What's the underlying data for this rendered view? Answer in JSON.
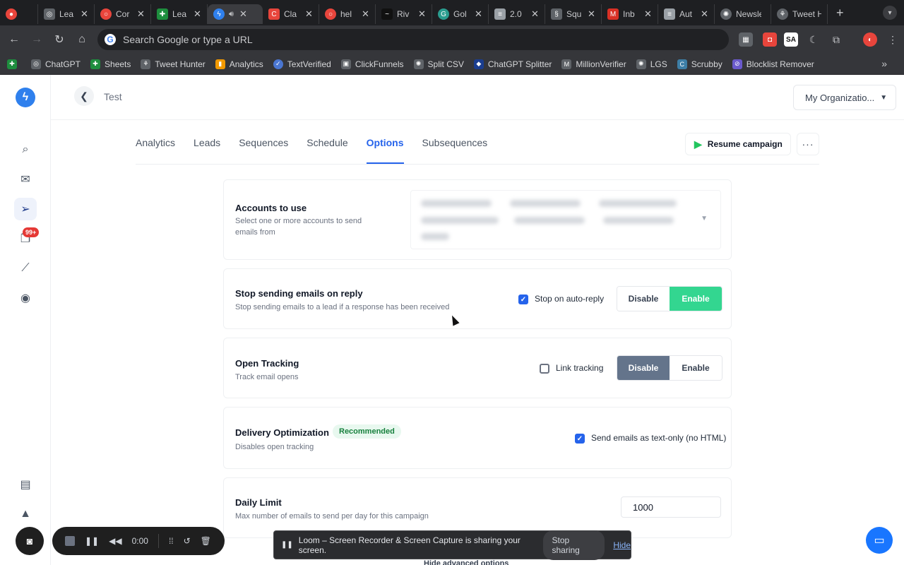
{
  "browser": {
    "tabs": [
      {
        "title": "",
        "color": "#e8453c",
        "icon": "record-icon"
      },
      {
        "title": "Lea",
        "color": "#5f6368",
        "icon": "openai-icon"
      },
      {
        "title": "Cor",
        "color": "#e8453c",
        "icon": "ring-icon"
      },
      {
        "title": "Lea",
        "color": "#1e8e3e",
        "icon": "sheets-icon"
      },
      {
        "title": "",
        "color": "#2f80ed",
        "icon": "bolt-icon",
        "active": true
      },
      {
        "title": "Cla",
        "color": "#e8453c",
        "icon": "c-icon"
      },
      {
        "title": "hel",
        "color": "#e8453c",
        "icon": "ring-icon"
      },
      {
        "title": "Riv",
        "color": "#111111",
        "icon": "wave-icon"
      },
      {
        "title": "Gol",
        "color": "#2a9d8f",
        "icon": "circle-icon"
      },
      {
        "title": "2.0",
        "color": "#9aa0a6",
        "icon": "doc-icon"
      },
      {
        "title": "Squ",
        "color": "#5f6368",
        "icon": "squiggle-icon"
      },
      {
        "title": "Inb",
        "color": "#d93025",
        "icon": "gmail-icon"
      },
      {
        "title": "Aut",
        "color": "#9aa0a6",
        "icon": "doc-icon"
      },
      {
        "title": "Newsle",
        "color": "#5f6368",
        "icon": "gear-icon"
      },
      {
        "title": "Tweet H",
        "color": "#5f6368",
        "icon": "tweet-icon"
      }
    ],
    "omnibox_placeholder": "Search Google or type a URL",
    "bookmarks": [
      {
        "label": "",
        "color": "#1e8e3e"
      },
      {
        "label": "ChatGPT",
        "color": "#5f6368"
      },
      {
        "label": "Sheets",
        "color": "#1e8e3e"
      },
      {
        "label": "Tweet Hunter",
        "color": "#5f6368"
      },
      {
        "label": "Analytics",
        "color": "#f29900"
      },
      {
        "label": "TextVerified",
        "color": "#4a76d1"
      },
      {
        "label": "ClickFunnels",
        "color": "#5f6368"
      },
      {
        "label": "Split CSV",
        "color": "#5f6368"
      },
      {
        "label": "ChatGPT Splitter",
        "color": "#1a3d8f"
      },
      {
        "label": "MillionVerifier",
        "color": "#5f6368"
      },
      {
        "label": "LGS",
        "color": "#5f6368"
      },
      {
        "label": "Scrubby",
        "color": "#3d7ea6"
      },
      {
        "label": "Blocklist Remover",
        "color": "#6a5acd"
      }
    ]
  },
  "app": {
    "breadcrumb": "Test",
    "org_selector": "My Organizatio...",
    "badge": "99+",
    "nav_tabs": [
      {
        "label": "Analytics",
        "active": false
      },
      {
        "label": "Leads",
        "active": false
      },
      {
        "label": "Sequences",
        "active": false
      },
      {
        "label": "Schedule",
        "active": false
      },
      {
        "label": "Options",
        "active": true
      },
      {
        "label": "Subsequences",
        "active": false
      }
    ],
    "resume_button": "Resume campaign",
    "accounts": {
      "title": "Accounts to use",
      "subtitle": "Select one or more accounts to send emails from"
    },
    "stop_on_reply": {
      "title": "Stop sending emails on reply",
      "subtitle": "Stop sending emails to a lead if a response has been received",
      "checkbox_label": "Stop on auto-reply",
      "checked": true,
      "disable_label": "Disable",
      "enable_label": "Enable",
      "selected": "Enable"
    },
    "open_tracking": {
      "title": "Open Tracking",
      "subtitle": "Track email opens",
      "checkbox_label": "Link tracking",
      "checked": false,
      "disable_label": "Disable",
      "enable_label": "Enable",
      "selected": "Disable"
    },
    "delivery": {
      "title": "Delivery Optimization",
      "badge": "Recommended",
      "subtitle": "Disables open tracking",
      "checkbox_label": "Send emails as text-only (no HTML)",
      "checked": true
    },
    "daily_limit": {
      "title": "Daily Limit",
      "subtitle": "Max number of emails to send per day for this campaign",
      "value": "1000"
    },
    "hide_advanced": "Hide advanced options"
  },
  "loom": {
    "timer": "0:00",
    "share_message": "Loom – Screen Recorder & Screen Capture is sharing your screen.",
    "stop_sharing": "Stop sharing",
    "hide": "Hide"
  },
  "colors": {
    "accent": "#2563eb",
    "enable_green": "#33d690",
    "disable_slate": "#64748b",
    "brand": "#2f80ed"
  }
}
